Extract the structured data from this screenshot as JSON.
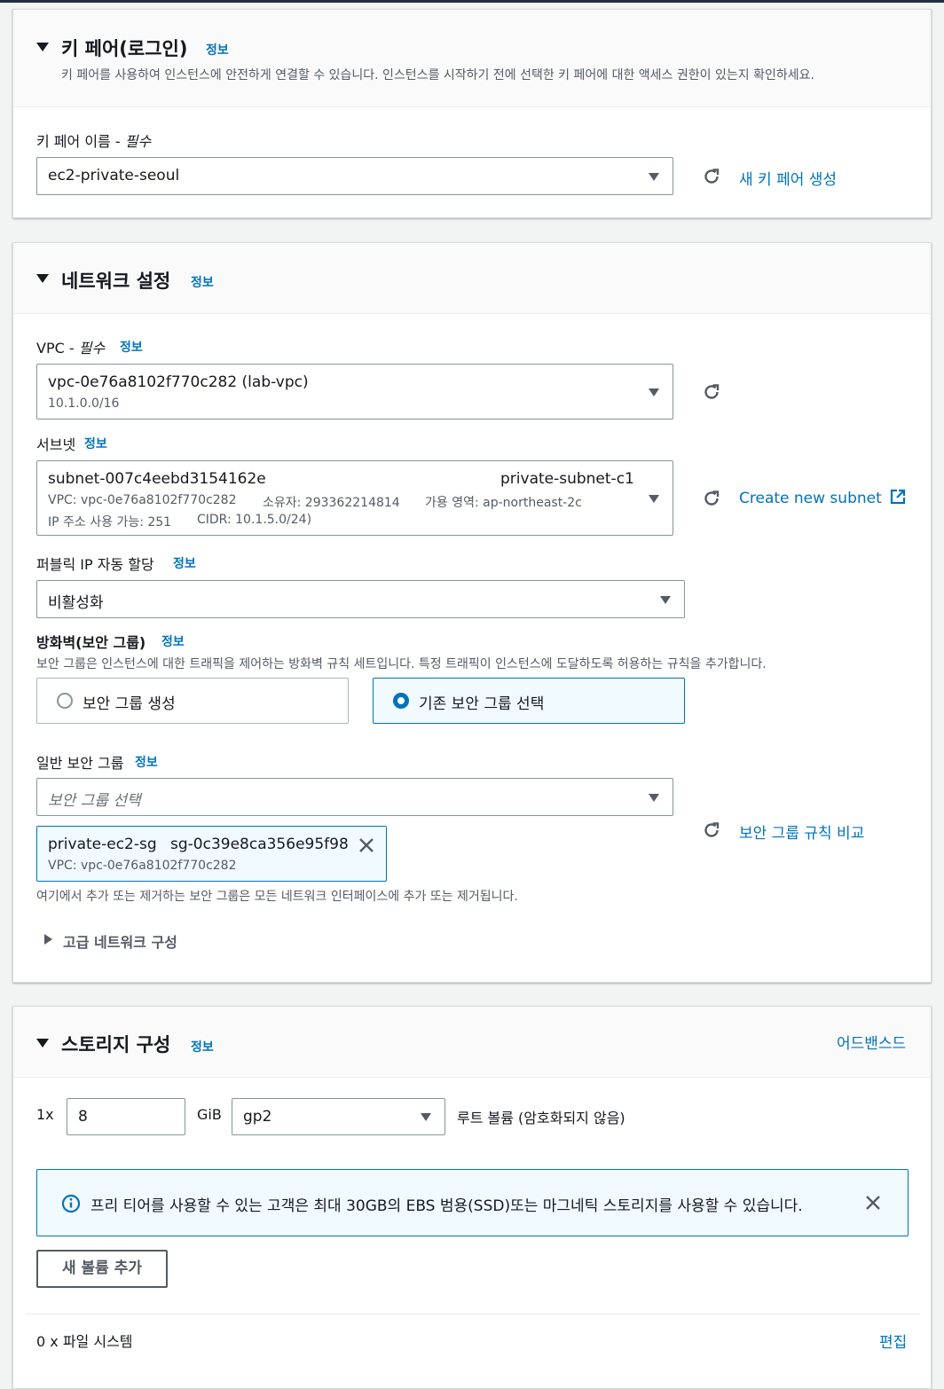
{
  "key_pair": {
    "title": "키 페어(로그인)",
    "info": "정보",
    "description": "키 페어를 사용하여 인스턴스에 안전하게 연결할 수 있습니다. 인스턴스를 시작하기 전에 선택한 키 페어에 대한 액세스 권한이 있는지 확인하세요.",
    "field_label": "키 페어 이름 - ",
    "required": "필수",
    "selected": "ec2-private-seoul",
    "create_link": "새 키 페어 생성"
  },
  "network": {
    "title": "네트워크 설정",
    "info": "정보",
    "vpc_label": "VPC - ",
    "vpc_required": "필수",
    "vpc_info": "정보",
    "vpc_value": "vpc-0e76a8102f770c282 (lab-vpc)",
    "vpc_cidr": "10.1.0.0/16",
    "subnet_label": "서브넷",
    "subnet_info": "정보",
    "subnet_id": "subnet-007c4eebd3154162e",
    "subnet_name": "private-subnet-c1",
    "subnet_vpc": "VPC: vpc-0e76a8102f770c282",
    "subnet_owner": "소유자: 293362214814",
    "subnet_az": "가용 영역: ap-northeast-2c",
    "subnet_ips": "IP 주소 사용 가능: 251",
    "subnet_cidr": "CIDR: 10.1.5.0/24)",
    "create_subnet_link": "Create new subnet",
    "public_ip_label": "퍼블릭 IP 자동 할당",
    "public_ip_info": "정보",
    "public_ip_value": "비활성화",
    "firewall_label": "방화벽(보안 그룹)",
    "firewall_info": "정보",
    "firewall_desc": "보안 그룹은 인스턴스에 대한 트래픽을 제어하는 방화벽 규칙 세트입니다. 특정 트래픽이 인스턴스에 도달하도록 허용하는 규칙을 추가합니다.",
    "radio_create": "보안 그룹 생성",
    "radio_existing": "기존 보안 그룹 선택",
    "sg_label": "일반 보안 그룹",
    "sg_info": "정보",
    "sg_placeholder": "보안 그룹 선택",
    "sg_token_name": "private-ec2-sg",
    "sg_token_id": "sg-0c39e8ca356e95f98",
    "sg_token_vpc": "VPC: vpc-0e76a8102f770c282",
    "compare_link": "보안 그룹 규칙 비교",
    "sg_note": "여기에서 추가 또는 제거하는 보안 그룹은 모든 네트워크 인터페이스에 추가 또는 제거됩니다.",
    "advanced": "고급 네트워크 구성"
  },
  "storage": {
    "title": "스토리지 구성",
    "info": "정보",
    "advanced_link": "어드밴스드",
    "count": "1x",
    "size": "8",
    "unit": "GiB",
    "volume_type": "gp2",
    "root_label": "루트 볼륨  (암호화되지 않음)",
    "alert_text": "프리 티어를 사용할 수 있는 고객은 최대 30GB의 EBS 범용(SSD)또는 마그네틱 스토리지를 사용할 수 있습니다.",
    "add_volume": "새 볼륨 추가",
    "file_systems": "0 x 파일 시스템",
    "edit_link": "편집"
  },
  "colors": {
    "link": "#0073bb",
    "text": "#16191f",
    "muted": "#545b64",
    "background": "#f2f3f3"
  }
}
